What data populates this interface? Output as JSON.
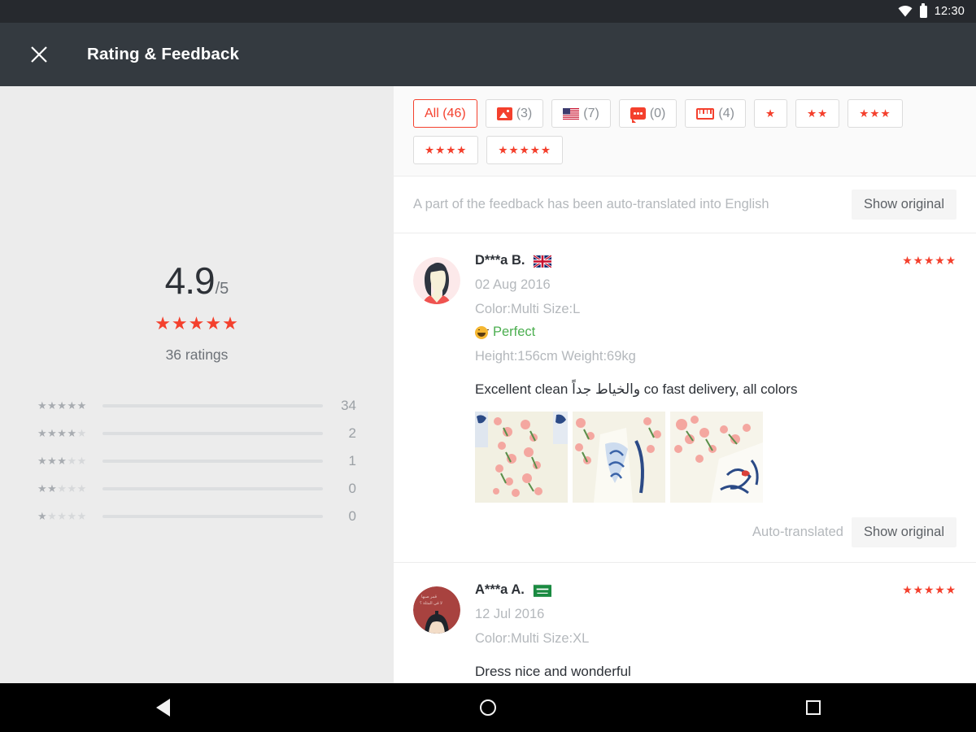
{
  "statusbar": {
    "time": "12:30",
    "wifi_icon": "wifi-icon",
    "battery_icon": "battery-icon"
  },
  "appbar": {
    "title": "Rating & Feedback",
    "close_icon": "close-icon"
  },
  "summary": {
    "score": "4.9",
    "denominator": "/5",
    "stars": "★★★★★",
    "ratings_label": "36 ratings",
    "star_color": "#f4402d",
    "histogram": [
      {
        "stars_on": "★★★★★",
        "stars_off": "",
        "count": "34",
        "percent": 94
      },
      {
        "stars_on": "★★★★",
        "stars_off": "★",
        "count": "2",
        "percent": 6
      },
      {
        "stars_on": "★★★",
        "stars_off": "★★",
        "count": "1",
        "percent": 1.5
      },
      {
        "stars_on": "★★",
        "stars_off": "★★★",
        "count": "0",
        "percent": 0
      },
      {
        "stars_on": "★",
        "stars_off": "★★★★",
        "count": "0",
        "percent": 0
      }
    ]
  },
  "filters": [
    {
      "label": "All (46)",
      "icon": "",
      "active": true
    },
    {
      "label": "(3)",
      "icon": "photo-icon",
      "active": false
    },
    {
      "label": "(7)",
      "icon": "us-flag-icon",
      "active": false
    },
    {
      "label": "(0)",
      "icon": "speech-bubble-icon",
      "active": false
    },
    {
      "label": "(4)",
      "icon": "ruler-icon",
      "active": false
    },
    {
      "label": "★",
      "icon": "",
      "active": false
    },
    {
      "label": "★★",
      "icon": "",
      "active": false
    },
    {
      "label": "★★★",
      "icon": "",
      "active": false
    },
    {
      "label": "★★★★",
      "icon": "",
      "active": false
    },
    {
      "label": "★★★★★",
      "icon": "",
      "active": false
    }
  ],
  "translate_bar": {
    "message": "A part of the feedback has been auto-translated into English",
    "button": "Show original"
  },
  "reviews": [
    {
      "name": "D***a B.",
      "flag": "uk-flag-icon",
      "avatar": "woman-avatar",
      "stars": "★★★★★",
      "date": "02 Aug 2016",
      "variant": "Color:Multi Size:L",
      "feeling": "Perfect",
      "feeling_icon": "grinning-face-icon",
      "feeling_color": "#4caf50",
      "body_stats": "Height:156cm Weight:69kg",
      "text": "Excellent clean والخياط جداً co fast delivery, all colors",
      "photos": [
        "review-photo-1",
        "review-photo-2",
        "review-photo-3"
      ],
      "auto_translated_label": "Auto-translated",
      "show_original_label": "Show original"
    },
    {
      "name": "A***a A.",
      "flag": "saudi-flag-icon",
      "avatar": "arabic-avatar",
      "stars": "★★★★★",
      "date": "12 Jul 2016",
      "variant": "Color:Multi Size:XL",
      "feeling": "",
      "feeling_icon": "",
      "feeling_color": "",
      "body_stats": "",
      "text": "Dress nice and wonderful",
      "photos": [],
      "auto_translated_label": "",
      "show_original_label": ""
    }
  ],
  "navbar": {
    "back_icon": "back-triangle-icon",
    "home_icon": "home-circle-icon",
    "recent_icon": "recent-square-icon"
  }
}
